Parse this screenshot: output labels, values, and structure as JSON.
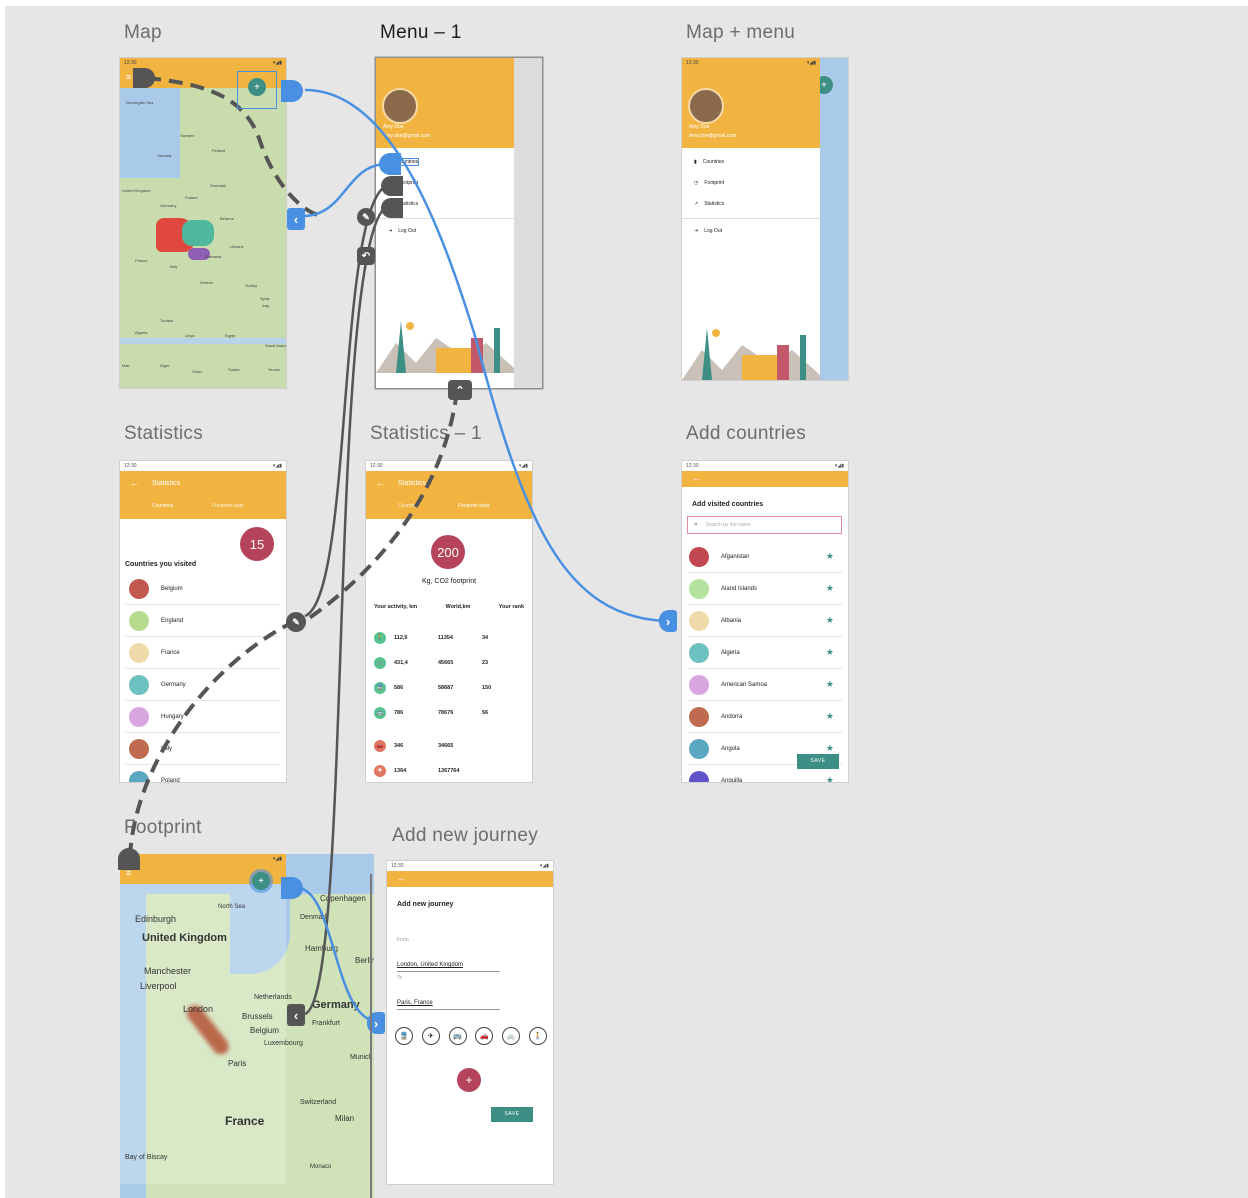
{
  "artboards": {
    "map": "Map",
    "menu1": "Menu – 1",
    "map_menu": "Map + menu",
    "statistics": "Statistics",
    "statistics1": "Statistics – 1",
    "add_countries": "Add countries",
    "footprint": "Footprint",
    "add_journey": "Add new journey"
  },
  "status_time": "12:30",
  "map_labels": [
    "Norwegian Sea",
    "Sweden",
    "Finland",
    "Norway",
    "Denmark",
    "United Kingdom",
    "Poland",
    "Germany",
    "Belarus",
    "Ukraine",
    "France",
    "Italy",
    "Romania",
    "Greece",
    "Turkey",
    "Syria",
    "Iraq",
    "Tunisia",
    "Algeria",
    "Libya",
    "Egypt",
    "Saudi Arabia",
    "Mali",
    "Niger",
    "Chad",
    "Sudan",
    "Yemen",
    "Morocco"
  ],
  "menu": {
    "user_name": "Amy Doe",
    "user_email": "Amy.doe@gmail.com",
    "items": [
      "Countries",
      "Footprint",
      "Statistics"
    ],
    "logout": "Log Out"
  },
  "statistics": {
    "title": "Statistics",
    "tabs": [
      "Countries",
      "Footprint stats"
    ],
    "count": "15",
    "heading": "Countries you visited",
    "countries": [
      {
        "name": "Belgium",
        "color": "#c1594f"
      },
      {
        "name": "England",
        "color": "#b6dd8f"
      },
      {
        "name": "France",
        "color": "#efd9a8"
      },
      {
        "name": "Germany",
        "color": "#6bc2c1"
      },
      {
        "name": "Hungary",
        "color": "#d7a6e0"
      },
      {
        "name": "Italy",
        "color": "#c06a4f"
      },
      {
        "name": "Poland",
        "color": "#5aa7c1"
      }
    ]
  },
  "statistics1": {
    "title": "Statistics",
    "tabs": [
      "Countries",
      "Footprint stats"
    ],
    "total": "200",
    "unit": "Kg, CO2 footprint",
    "columns": [
      "Your activity, km",
      "World,km",
      "Your rank"
    ],
    "rows": [
      {
        "icon": "walk-icon",
        "glyph": "🚶",
        "color": "#59c38f",
        "km": "112,6",
        "world": "11354",
        "rank": "34"
      },
      {
        "icon": "bike-icon",
        "glyph": "🚲",
        "color": "#59c38f",
        "km": "431,4",
        "world": "45665",
        "rank": "23"
      },
      {
        "icon": "train-icon",
        "glyph": "🚆",
        "color": "#59c38f",
        "km": "586",
        "world": "58687",
        "rank": "150"
      },
      {
        "icon": "bus-icon",
        "glyph": "🚌",
        "color": "#59c38f",
        "km": "786",
        "world": "78676",
        "rank": "56"
      },
      {
        "icon": "car-icon",
        "glyph": "🚗",
        "color": "#e0765f",
        "km": "346",
        "world": "34665",
        "rank": ""
      },
      {
        "icon": "plane-icon",
        "glyph": "✈",
        "color": "#e0765f",
        "km": "1364",
        "world": "1367764",
        "rank": ""
      }
    ]
  },
  "add_countries": {
    "heading": "Add visited countries",
    "search_placeholder": "Search by the name",
    "countries": [
      {
        "name": "Afganistan",
        "color": "#c1464f"
      },
      {
        "name": "Aland Islands",
        "color": "#b6e2a0"
      },
      {
        "name": "Albania",
        "color": "#efd9a8"
      },
      {
        "name": "Algeria",
        "color": "#6bc2c1"
      },
      {
        "name": "American Samoa",
        "color": "#d7a6e0"
      },
      {
        "name": "Andorra",
        "color": "#c06a4f"
      },
      {
        "name": "Angola",
        "color": "#5aa7c1"
      },
      {
        "name": "Anguilla",
        "color": "#5f55c9"
      }
    ],
    "save": "SAVE"
  },
  "footprint_labels": [
    "North Sea",
    "Copenhagen",
    "Denmark",
    "Edinburgh",
    "United Kingdom",
    "Hamburg",
    "Berlin",
    "Manchester",
    "Liverpool",
    "Netherlands",
    "London",
    "Germany",
    "Brussels",
    "Belgium",
    "Luxembourg",
    "Frankfurt",
    "Paris",
    "Munich",
    "France",
    "Switzerland",
    "Milan",
    "Bay of Biscay",
    "Monaco"
  ],
  "add_journey": {
    "heading": "Add new journey",
    "from_label": "From",
    "from_value": "London, United Kingdom",
    "to_label": "To",
    "to_value": "Paris, France",
    "modes": [
      {
        "icon": "train-icon",
        "glyph": "🚆"
      },
      {
        "icon": "plane-icon",
        "glyph": "✈"
      },
      {
        "icon": "bus-icon",
        "glyph": "🚌"
      },
      {
        "icon": "car-icon",
        "glyph": "🚗"
      },
      {
        "icon": "bike-icon",
        "glyph": "🚲"
      },
      {
        "icon": "walk-icon",
        "glyph": "🚶"
      }
    ],
    "save": "SAVE"
  },
  "colors": {
    "canvas": "#e6e6e6",
    "appbar": "#f2b441",
    "accent_teal": "#3d8f86",
    "badge": "#b5445a",
    "wire_blue": "#4a90e2",
    "wire_gray": "#555555"
  }
}
